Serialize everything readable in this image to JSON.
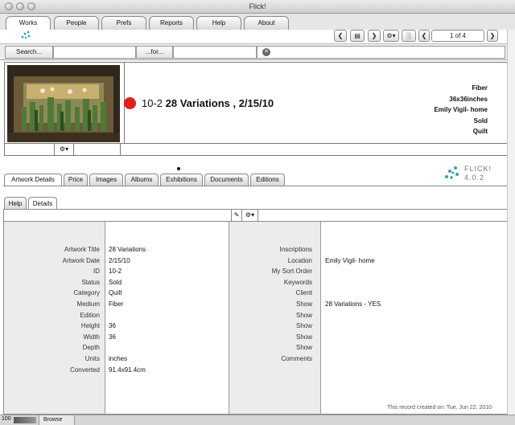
{
  "window": {
    "title": "Flick!"
  },
  "main_tabs": [
    {
      "label": "Works",
      "active": true
    },
    {
      "label": "People",
      "active": false
    },
    {
      "label": "Prefs",
      "active": false
    },
    {
      "label": "Reports",
      "active": false
    },
    {
      "label": "Help",
      "active": false
    },
    {
      "label": "About",
      "active": false
    }
  ],
  "toolbar": {
    "record_counter": "1 of 4",
    "buttons": [
      "chevron-left-icon",
      "layout-icon",
      "chevron-right-icon",
      "gear-icon",
      "bar-chart-icon",
      "chevron-left-icon",
      "chevron-right-icon"
    ]
  },
  "search": {
    "search_label": "Search...",
    "for_label": "...for...",
    "search_value": "",
    "for_value": ""
  },
  "record": {
    "id": "10-2",
    "title": "28 Variations , 2/15/10",
    "status_color": "#e0201a",
    "medium": "Fiber",
    "size": "36x36inches",
    "location": "Emily Vigil- home",
    "status": "Sold",
    "category": "Quilt"
  },
  "brand": {
    "name": "FLICK!",
    "version": "4.0.2",
    "accent": "#3d9db0"
  },
  "detail_tabs": [
    {
      "label": "Artwork Details",
      "active": true
    },
    {
      "label": "Price",
      "active": false
    },
    {
      "label": "Images",
      "active": false
    },
    {
      "label": "Albums",
      "active": false
    },
    {
      "label": "Exhibitions",
      "active": false
    },
    {
      "label": "Documents",
      "active": false
    },
    {
      "label": "Editions",
      "active": false
    }
  ],
  "inner_tabs": [
    {
      "label": "Help",
      "active": false
    },
    {
      "label": "Details",
      "active": true
    }
  ],
  "left_fields": [
    {
      "label": "Artwork Title",
      "value": "28 Variations"
    },
    {
      "label": "Artwork Date",
      "value": "2/15/10"
    },
    {
      "label": "ID",
      "value": "10-2"
    },
    {
      "label": "Status",
      "value": "Sold"
    },
    {
      "label": "Category",
      "value": "Quilt"
    },
    {
      "label": "Medium",
      "value": "Fiber"
    },
    {
      "label": "Edition",
      "value": ""
    },
    {
      "label": "Height",
      "value": "36"
    },
    {
      "label": "Width",
      "value": "36"
    },
    {
      "label": "Depth",
      "value": ""
    },
    {
      "label": "Units",
      "value": "inches"
    },
    {
      "label": "Converted",
      "value": "91.4x91.4cm"
    }
  ],
  "right_fields": [
    {
      "label": "Inscriptions",
      "value": ""
    },
    {
      "label": "Location",
      "value": "Emily Vigil- home"
    },
    {
      "label": "My Sort Order",
      "value": ""
    },
    {
      "label": "Keywords",
      "value": ""
    },
    {
      "label": "Client",
      "value": ""
    },
    {
      "label": "Show",
      "value": "28 Variations - YES"
    },
    {
      "label": "Show",
      "value": ""
    },
    {
      "label": "Show",
      "value": ""
    },
    {
      "label": "Show",
      "value": ""
    },
    {
      "label": "Show",
      "value": ""
    },
    {
      "label": "Comments",
      "value": ""
    }
  ],
  "footer": {
    "created": "This record created on: Tue, Jun 22, 2010"
  },
  "statusbar": {
    "zoom": "100",
    "mode": "Browse"
  }
}
